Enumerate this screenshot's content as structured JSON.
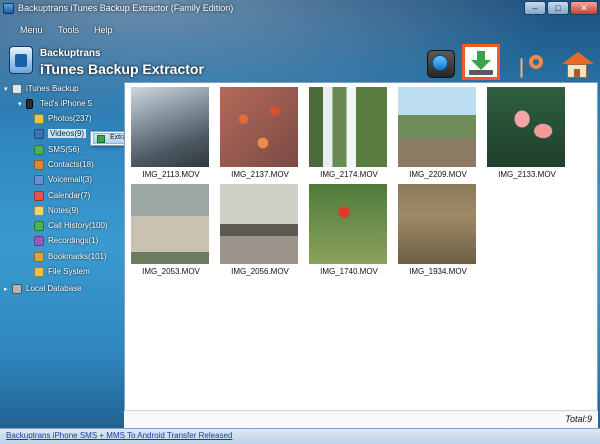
{
  "window": {
    "title": "Backuptrans iTunes Backup Extractor (Family Edition)",
    "controls": [
      "–",
      "□",
      "✕"
    ]
  },
  "menu": [
    "Menu",
    "Tools",
    "Help"
  ],
  "brand": {
    "line1": "Backuptrans",
    "line2": "iTunes Backup Extractor"
  },
  "toolbar": {
    "buttons": [
      "transfer-to-itunes-icon",
      "extract-download-icon",
      "register-key-icon",
      "home-icon"
    ],
    "highlight_color": "#f05a26"
  },
  "tree": {
    "root": "iTunes Backup",
    "device": "Ted's iPhone 5",
    "items": [
      {
        "label": "Photos(237)",
        "icon": "photos-icon"
      },
      {
        "label": "Videos(9)",
        "icon": "videos-icon"
      },
      {
        "label": "SMS(56)",
        "icon": "sms-icon"
      },
      {
        "label": "Contacts(18)",
        "icon": "contacts-icon"
      },
      {
        "label": "Voicemail(3)",
        "icon": "voicemail-icon"
      },
      {
        "label": "Calendar(7)",
        "icon": "calendar-icon"
      },
      {
        "label": "Notes(9)",
        "icon": "notes-icon"
      },
      {
        "label": "Call History(100)",
        "icon": "call-history-icon"
      },
      {
        "label": "Recordings(1)",
        "icon": "recordings-icon"
      },
      {
        "label": "Bookmarks(101)",
        "icon": "bookmarks-icon"
      },
      {
        "label": "File System",
        "icon": "folder-icon"
      }
    ],
    "local": "Local Database"
  },
  "context_menu": {
    "extract": "Extract"
  },
  "videos": [
    {
      "name": "IMG_2113.MOV"
    },
    {
      "name": "IMG_2137.MOV"
    },
    {
      "name": "IMG_2174.MOV"
    },
    {
      "name": "IMG_2209.MOV"
    },
    {
      "name": "IMG_2133.MOV"
    },
    {
      "name": "IMG_2053.MOV"
    },
    {
      "name": "IMG_2056.MOV"
    },
    {
      "name": "IMG_1740.MOV"
    },
    {
      "name": "IMG_1934.MOV"
    }
  ],
  "status": {
    "total": "Total:9"
  },
  "footer": {
    "link": "Backuptrans iPhone SMS + MMS To Android Transfer Released"
  }
}
